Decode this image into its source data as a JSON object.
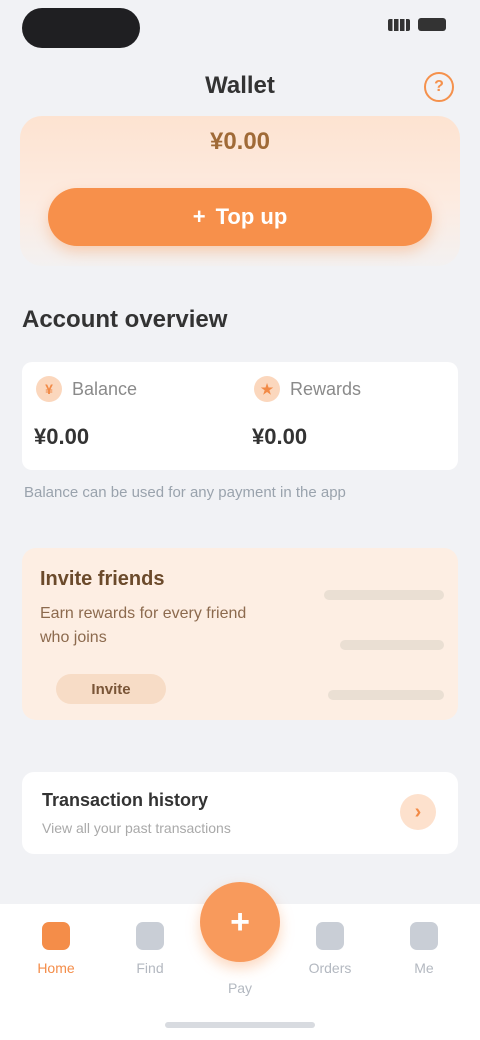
{
  "header": {
    "title": "Wallet",
    "help_icon": "question-icon"
  },
  "hero": {
    "amount": "¥0.00",
    "button_label": "Top up"
  },
  "overview": {
    "title": "Account overview",
    "stats": [
      {
        "label": "Balance",
        "value": "¥0.00",
        "icon": "wallet-icon"
      },
      {
        "label": "Rewards",
        "value": "¥0.00",
        "icon": "coin-icon"
      }
    ],
    "note": "Balance can be used for any payment in the app"
  },
  "promo": {
    "title": "Invite friends",
    "description": "Earn rewards for every friend who joins",
    "button_label": "Invite"
  },
  "info": {
    "title": "Transaction history",
    "subtitle": "View all your past transactions",
    "icon": "arrow-right-icon"
  },
  "tabbar": {
    "items": [
      {
        "label": "Home"
      },
      {
        "label": "Find"
      },
      {
        "label": "Pay"
      },
      {
        "label": "Orders"
      },
      {
        "label": "Me"
      }
    ],
    "center_icon": "plus-icon"
  },
  "colors": {
    "accent": "#f7904b",
    "promo_bg": "#fdeee3",
    "page_bg": "#f1f2f5"
  }
}
